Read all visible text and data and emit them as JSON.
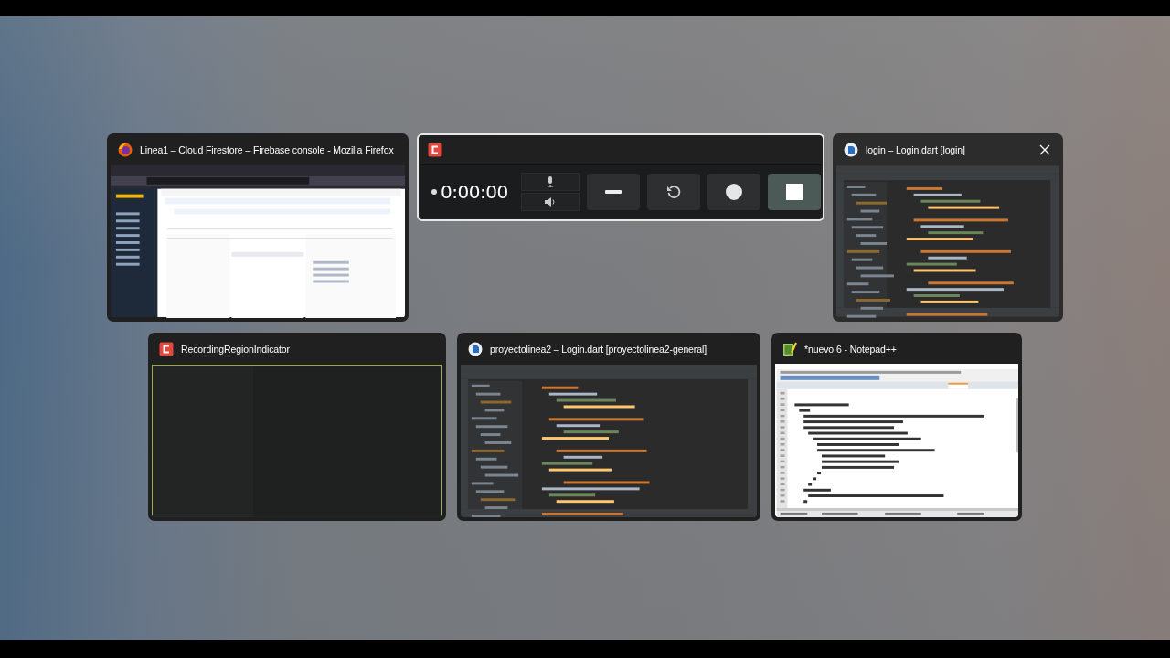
{
  "windows": [
    {
      "title": "Linea1 – Cloud Firestore – Firebase console - Mozilla Firefox",
      "kind": "browser",
      "selected": false,
      "hovered": false
    },
    {
      "kind": "recorder",
      "timer": "0:00:00",
      "selected": true,
      "hovered": false
    },
    {
      "title": "login – Login.dart [login]",
      "kind": "ide",
      "selected": false,
      "hovered": true
    },
    {
      "title": "RecordingRegionIndicator",
      "kind": "region",
      "selected": false,
      "hovered": false
    },
    {
      "title": "proyectolinea2 – Login.dart [proyectolinea2-general]",
      "kind": "ide",
      "selected": false,
      "hovered": false
    },
    {
      "title": "*nuevo 6 - Notepad++",
      "kind": "notepad",
      "selected": false,
      "hovered": false
    }
  ]
}
